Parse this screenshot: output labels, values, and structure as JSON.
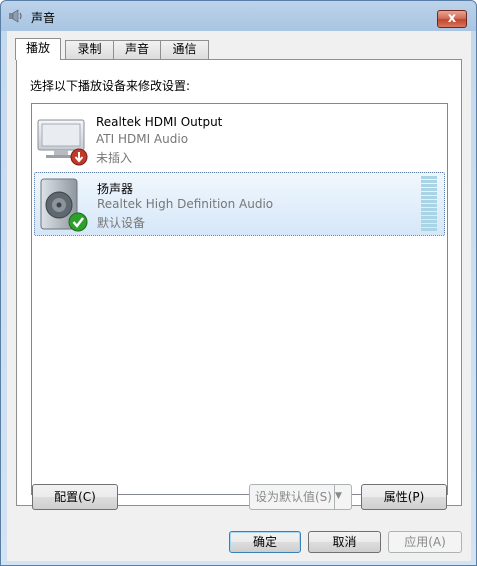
{
  "window": {
    "title": "声音",
    "close_label": "x"
  },
  "tabs": [
    {
      "label": "播放",
      "active": true
    },
    {
      "label": "录制",
      "active": false
    },
    {
      "label": "声音",
      "active": false
    },
    {
      "label": "通信",
      "active": false
    }
  ],
  "instruction": "选择以下播放设备来修改设置:",
  "devices": [
    {
      "name": "Realtek HDMI Output",
      "driver": "ATI HDMI Audio",
      "status": "未插入",
      "icon": "monitor-icon",
      "badge": "down-arrow-badge"
    },
    {
      "name": "扬声器",
      "driver": "Realtek High Definition Audio",
      "status": "默认设备",
      "icon": "speaker-icon",
      "badge": "checkmark-badge"
    }
  ],
  "buttons": {
    "configure": "配置(C)",
    "set_default": "设为默认值(S)",
    "properties": "属性(P)",
    "ok": "确定",
    "cancel": "取消",
    "apply": "应用(A)"
  },
  "colors": {
    "selection": "#d5e7f8",
    "check_green": "#2ea02e",
    "badge_red": "#c0392b"
  }
}
